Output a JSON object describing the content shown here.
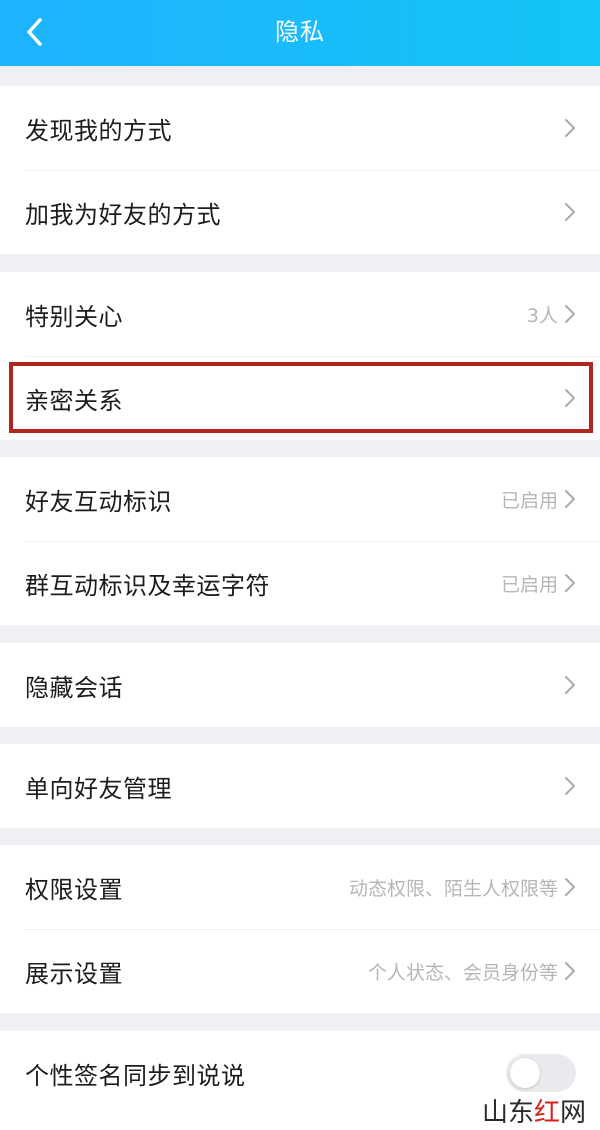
{
  "header": {
    "title": "隐私",
    "back_icon": "chevron-left-icon"
  },
  "groups": [
    {
      "items": [
        {
          "label": "发现我的方式",
          "value": ""
        },
        {
          "label": "加我为好友的方式",
          "value": ""
        }
      ]
    },
    {
      "items": [
        {
          "label": "特别关心",
          "value": "3人"
        },
        {
          "label": "亲密关系",
          "value": ""
        }
      ]
    },
    {
      "items": [
        {
          "label": "好友互动标识",
          "value": "已启用"
        },
        {
          "label": "群互动标识及幸运字符",
          "value": "已启用"
        }
      ]
    },
    {
      "items": [
        {
          "label": "隐藏会话",
          "value": ""
        }
      ]
    },
    {
      "items": [
        {
          "label": "单向好友管理",
          "value": ""
        }
      ]
    },
    {
      "items": [
        {
          "label": "权限设置",
          "value": "动态权限、陌生人权限等"
        },
        {
          "label": "展示设置",
          "value": "个人状态、会员身份等"
        }
      ]
    },
    {
      "items": [
        {
          "label": "个性签名同步到说说",
          "toggle_on": false
        }
      ]
    }
  ],
  "watermark": {
    "part1": "山东",
    "part2": "红",
    "part3": "网"
  },
  "colors": {
    "header": "#1fb2ff",
    "highlight_border": "#b0271f",
    "background": "#eef0f3"
  }
}
